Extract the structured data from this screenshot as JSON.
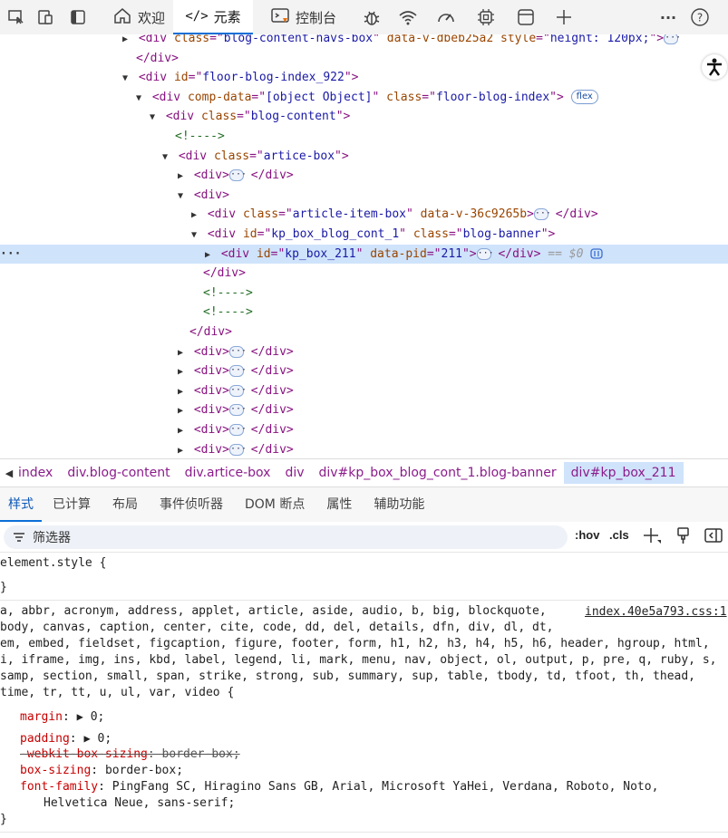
{
  "toolbar": {
    "tabs": [
      {
        "label": "欢迎",
        "icon": "home-icon"
      },
      {
        "label": "元素",
        "icon": "code-icon"
      },
      {
        "label": "控制台",
        "icon": "console-icon"
      }
    ],
    "right_icons": [
      "bug-icon",
      "wifi-icon",
      "performance-icon",
      "cpu-icon",
      "application-icon",
      "plus-icon",
      "more-icon",
      "help-icon"
    ],
    "more": "···",
    "help": "?"
  },
  "dom": {
    "lines": [
      {
        "indent": 135,
        "tri": "▶",
        "parts": [
          [
            "tag",
            "<div "
          ],
          [
            "attr",
            "class"
          ],
          [
            "tag",
            "=\""
          ],
          [
            "val",
            "blog-content-navs-box"
          ],
          [
            "tag",
            "\" "
          ],
          [
            "attr",
            "data-v-dbeb25a2 style"
          ],
          [
            "tag",
            "=\""
          ],
          [
            "val",
            "height: 120px;"
          ],
          [
            "tag",
            "\">"
          ]
        ],
        "dots": true,
        "clipped": true
      },
      {
        "indent": 150,
        "tri": "",
        "parts": [
          [
            "tag",
            "</div>"
          ]
        ]
      },
      {
        "indent": 135,
        "tri": "▼",
        "parts": [
          [
            "tag",
            "<div "
          ],
          [
            "attr",
            "id"
          ],
          [
            "tag",
            "=\""
          ],
          [
            "val",
            "floor-blog-index_922"
          ],
          [
            "tag",
            "\">"
          ]
        ]
      },
      {
        "indent": 150,
        "tri": "▼",
        "parts": [
          [
            "tag",
            "<div "
          ],
          [
            "attr",
            "comp-data"
          ],
          [
            "tag",
            "=\""
          ],
          [
            "val",
            "[object Object]"
          ],
          [
            "tag",
            "\" "
          ],
          [
            "attr",
            "class"
          ],
          [
            "tag",
            "=\""
          ],
          [
            "val",
            "floor-blog-index"
          ],
          [
            "tag",
            "\">"
          ]
        ],
        "badge": "flex"
      },
      {
        "indent": 165,
        "tri": "▼",
        "parts": [
          [
            "tag",
            "<div "
          ],
          [
            "attr",
            "class"
          ],
          [
            "tag",
            "=\""
          ],
          [
            "val",
            "blog-content"
          ],
          [
            "tag",
            "\">"
          ]
        ]
      },
      {
        "indent": 193,
        "tri": "",
        "parts": [
          [
            "cmt",
            "<!---->"
          ]
        ]
      },
      {
        "indent": 179,
        "tri": "▼",
        "parts": [
          [
            "tag",
            "<div "
          ],
          [
            "attr",
            "class"
          ],
          [
            "tag",
            "=\""
          ],
          [
            "val",
            "artice-box"
          ],
          [
            "tag",
            "\">"
          ]
        ]
      },
      {
        "indent": 196,
        "tri": "▶",
        "parts": [
          [
            "tag",
            "<div>"
          ]
        ],
        "dots": true,
        "close": "</div>"
      },
      {
        "indent": 196,
        "tri": "▼",
        "parts": [
          [
            "tag",
            "<div>"
          ]
        ]
      },
      {
        "indent": 211,
        "tri": "▶",
        "parts": [
          [
            "tag",
            "<div "
          ],
          [
            "attr",
            "class"
          ],
          [
            "tag",
            "=\""
          ],
          [
            "val",
            "article-item-box"
          ],
          [
            "tag",
            "\" "
          ],
          [
            "attr",
            "data-v-36c9265b"
          ],
          [
            "tag",
            ">"
          ]
        ],
        "dots": true,
        "close": "</div>"
      },
      {
        "indent": 211,
        "tri": "▼",
        "parts": [
          [
            "tag",
            "<div "
          ],
          [
            "attr",
            "id"
          ],
          [
            "tag",
            "=\""
          ],
          [
            "val",
            "kp_box_blog_cont_1"
          ],
          [
            "tag",
            "\" "
          ],
          [
            "attr",
            "class"
          ],
          [
            "tag",
            "=\""
          ],
          [
            "val",
            "blog-banner"
          ],
          [
            "tag",
            "\">"
          ]
        ]
      },
      {
        "indent": 226,
        "tri": "▶",
        "parts": [
          [
            "tag",
            "<div "
          ],
          [
            "attr",
            "id"
          ],
          [
            "tag",
            "=\""
          ],
          [
            "val",
            "kp_box_211"
          ],
          [
            "tag",
            "\" "
          ],
          [
            "attr",
            "data-pid"
          ],
          [
            "tag",
            "=\""
          ],
          [
            "val",
            "211"
          ],
          [
            "tag",
            "\">"
          ]
        ],
        "dots": true,
        "close": "</div>",
        "selected": true
      },
      {
        "indent": 224,
        "tri": "",
        "parts": [
          [
            "tag",
            "</div>"
          ]
        ]
      },
      {
        "indent": 224,
        "tri": "",
        "parts": [
          [
            "cmt",
            "<!---->"
          ]
        ]
      },
      {
        "indent": 224,
        "tri": "",
        "parts": [
          [
            "cmt",
            "<!---->"
          ]
        ]
      },
      {
        "indent": 209,
        "tri": "",
        "parts": [
          [
            "tag",
            "</div>"
          ]
        ]
      },
      {
        "indent": 196,
        "tri": "▶",
        "parts": [
          [
            "tag",
            "<div>"
          ]
        ],
        "dots": true,
        "close": "</div>"
      },
      {
        "indent": 196,
        "tri": "▶",
        "parts": [
          [
            "tag",
            "<div>"
          ]
        ],
        "dots": true,
        "close": "</div>"
      },
      {
        "indent": 196,
        "tri": "▶",
        "parts": [
          [
            "tag",
            "<div>"
          ]
        ],
        "dots": true,
        "close": "</div>"
      },
      {
        "indent": 196,
        "tri": "▶",
        "parts": [
          [
            "tag",
            "<div>"
          ]
        ],
        "dots": true,
        "close": "</div>"
      },
      {
        "indent": 196,
        "tri": "▶",
        "parts": [
          [
            "tag",
            "<div>"
          ]
        ],
        "dots": true,
        "close": "</div>"
      },
      {
        "indent": 196,
        "tri": "▶",
        "parts": [
          [
            "tag",
            "<div>"
          ]
        ],
        "dots": true,
        "close": "</div>"
      }
    ],
    "selected_suffix": "== $0",
    "gutter_dots": "···"
  },
  "breadcrumb": {
    "items": [
      "index",
      "div.blog-content",
      "div.artice-box",
      "div",
      "div#kp_box_blog_cont_1.blog-banner",
      "div#kp_box_211"
    ]
  },
  "subtabs": [
    "样式",
    "已计算",
    "布局",
    "事件侦听器",
    "DOM 断点",
    "属性",
    "辅助功能"
  ],
  "filter": {
    "placeholder": "筛选器",
    "hov": ":hov",
    "cls": ".cls"
  },
  "styles": {
    "element_style_open": "element.style {",
    "close_brace": "}",
    "source_link": "index.40e5a793.css:1",
    "selector_lines": [
      "a, abbr, acronym, address, applet, article, aside, audio, b, big, blockquote,",
      "body, canvas, caption, center, cite, code, dd, del, details, dfn, div, dl, dt,",
      "em, embed, fieldset, figcaption, figure, footer, form, h1, h2, h3, h4, h5, h6, header, hgroup, html,",
      "i, iframe, img, ins, kbd, label, legend, li, mark, menu, nav, object, ol, output, p, pre, q, ruby, s,",
      "samp, section, small, span, strike, strong, sub, summary, sup, table, tbody, td, tfoot, th, thead,",
      "time, tr, tt, u, ul, var, video {"
    ],
    "props": [
      {
        "name": "margin",
        "value": "0;",
        "expand": true
      },
      {
        "name": "padding",
        "value": "0;",
        "expand": true
      },
      {
        "name": "-webkit-box-sizing",
        "value": "border-box;",
        "struck": true
      },
      {
        "name": "box-sizing",
        "value": "border-box;"
      },
      {
        "name": "font-family",
        "value": "PingFang SC, Hiragino Sans GB, Arial, Microsoft YaHei, Verdana, Roboto, Noto,"
      },
      {
        "name": "",
        "value": "Helvetica Neue, sans-serif;",
        "continuation": true
      }
    ]
  }
}
